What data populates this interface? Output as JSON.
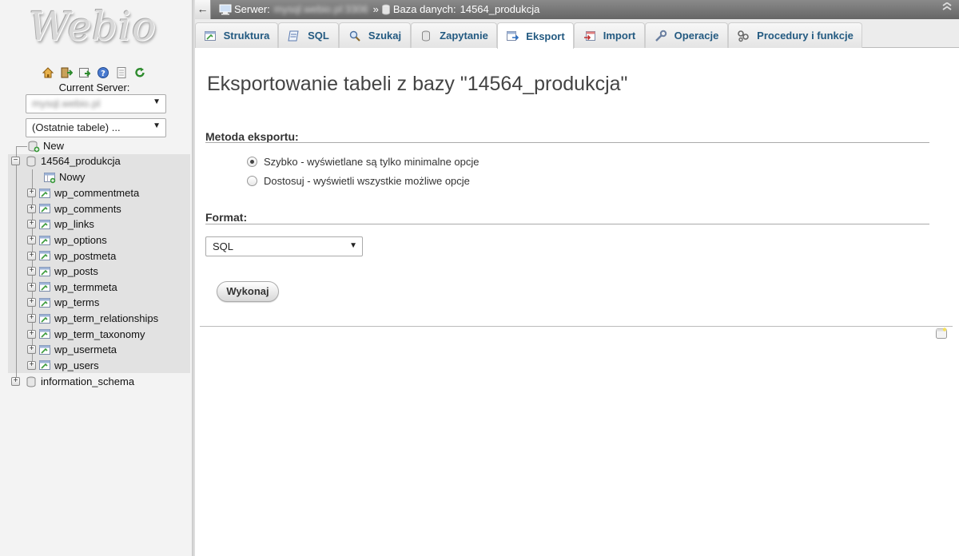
{
  "nav": {
    "logo": "Webio",
    "icons": [
      "home-icon",
      "logout-icon",
      "query-window-icon",
      "docs-icon",
      "settings-icon",
      "reload-icon"
    ],
    "current_server_label": "Current Server:",
    "server_value": "mysql.webio.pl",
    "recent_tables": "(Ostatnie tabele) ...",
    "tree": {
      "new_label": "New",
      "database": "14564_produkcja",
      "new_table_label": "Nowy",
      "tables": [
        "wp_commentmeta",
        "wp_comments",
        "wp_links",
        "wp_options",
        "wp_postmeta",
        "wp_posts",
        "wp_termmeta",
        "wp_terms",
        "wp_term_relationships",
        "wp_term_taxonomy",
        "wp_usermeta",
        "wp_users"
      ],
      "other_database": "information_schema"
    }
  },
  "breadcrumb": {
    "server_label": "Serwer:",
    "server_value": "mysql.webio.pl:3306",
    "separator": "»",
    "database_label": "Baza danych:",
    "database_value": "14564_produkcja"
  },
  "tabs": [
    {
      "label": "Struktura",
      "icon": "structure-icon"
    },
    {
      "label": "SQL",
      "icon": "sql-icon"
    },
    {
      "label": "Szukaj",
      "icon": "search-icon"
    },
    {
      "label": "Zapytanie",
      "icon": "query-icon"
    },
    {
      "label": "Eksport",
      "icon": "export-icon",
      "active": true
    },
    {
      "label": "Import",
      "icon": "import-icon"
    },
    {
      "label": "Operacje",
      "icon": "wrench-icon"
    },
    {
      "label": "Procedury i funkcje",
      "icon": "routines-icon"
    }
  ],
  "main": {
    "title": "Eksportowanie tabeli z bazy \"14564_produkcja\"",
    "method_label": "Metoda eksportu:",
    "method_quick": "Szybko - wyświetlane są tylko minimalne opcje",
    "method_custom": "Dostosuj - wyświetli wszystkie możliwe opcje",
    "format_label": "Format:",
    "format_value": "SQL",
    "go_button": "Wykonaj"
  },
  "colors": {
    "tab_text": "#235a81",
    "topbar": "#777777",
    "nav_background": "#f3f3f3"
  }
}
